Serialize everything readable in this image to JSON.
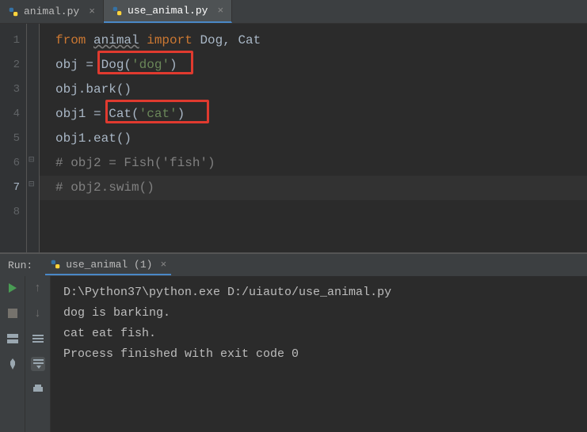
{
  "tabs": [
    {
      "label": "animal.py"
    },
    {
      "label": "use_animal.py"
    }
  ],
  "code": {
    "lines": [
      "1",
      "2",
      "3",
      "4",
      "5",
      "6",
      "7",
      "8"
    ],
    "l1": {
      "from": "from ",
      "mod": "animal",
      "imp": " import ",
      "names": "Dog, Cat"
    },
    "l2": {
      "pre": "obj = ",
      "call": "Dog",
      "paren1": "(",
      "arg": "'dog'",
      "paren2": ")"
    },
    "l3": {
      "pre": "obj.",
      "call": "bark",
      "after": "()"
    },
    "l4": {
      "pre": "obj1 = ",
      "call": "Cat",
      "paren1": "(",
      "arg": "'cat'",
      "paren2": ")"
    },
    "l5": {
      "pre": "obj1.",
      "call": "eat",
      "after": "()"
    },
    "l6": {
      "text": "# obj2 = Fish('fish')"
    },
    "l7": {
      "text": "# obj2.swim()"
    }
  },
  "run": {
    "label": "Run:",
    "tab": "use_animal (1)",
    "out1": "D:\\Python37\\python.exe D:/uiauto/use_animal.py",
    "out2": "dog is barking.",
    "out3": "cat eat fish.",
    "out4": "",
    "out5": "Process finished with exit code 0"
  }
}
